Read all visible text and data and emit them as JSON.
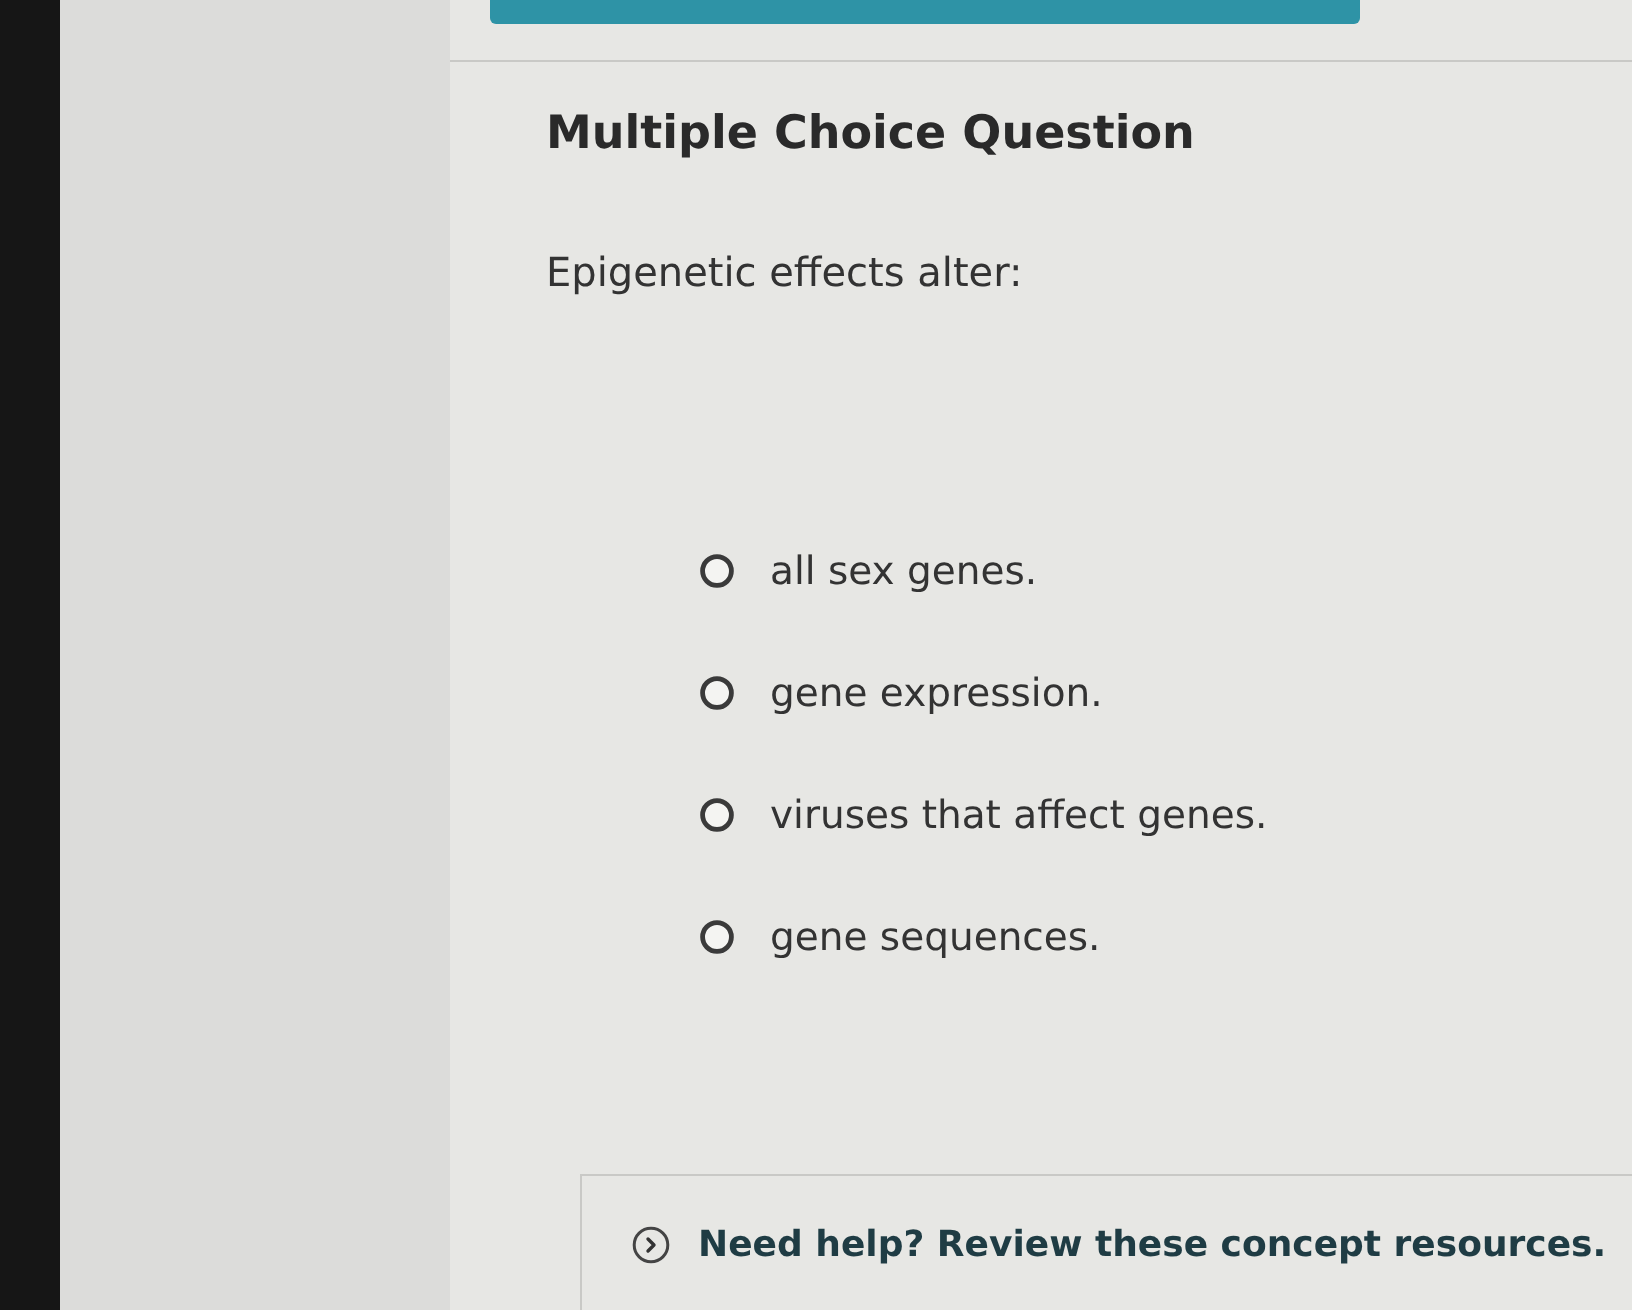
{
  "title": "Multiple Choice Question",
  "question": "Epigenetic effects alter:",
  "options": [
    {
      "label": "all sex genes.",
      "selected": false
    },
    {
      "label": "gene expression.",
      "selected": false
    },
    {
      "label": "viruses that affect genes.",
      "selected": false
    },
    {
      "label": "gene sequences.",
      "selected": false
    }
  ],
  "help": {
    "label": "Need help? Review these concept resources.",
    "expanded": false
  }
}
